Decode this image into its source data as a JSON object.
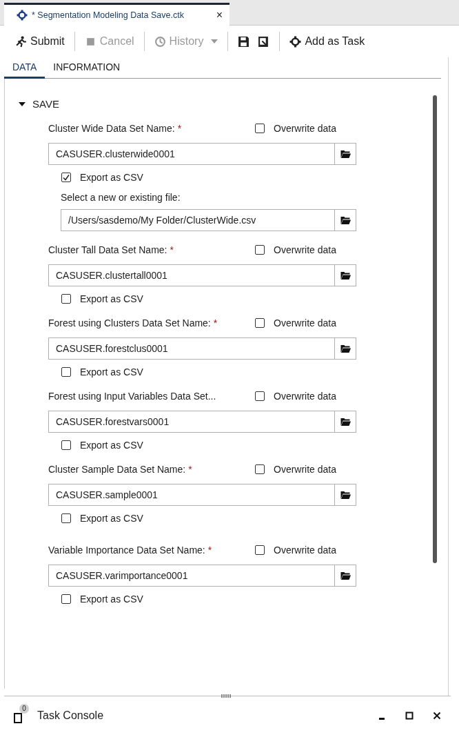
{
  "document_tab": {
    "title": "* Segmentation Modeling Data Save.ctk",
    "close": "×"
  },
  "toolbar": [
    {
      "kind": "submit",
      "label": "Submit",
      "disabled": false
    },
    {
      "kind": "cancel",
      "label": "Cancel",
      "disabled": true
    },
    {
      "kind": "history",
      "label": "History",
      "disabled": true
    },
    {
      "kind": "save",
      "disabled": false
    },
    {
      "kind": "save_as",
      "disabled": false
    },
    {
      "kind": "add_task",
      "label": "Add as Task",
      "disabled": false
    }
  ],
  "tabs": [
    {
      "label": "DATA",
      "selected": true
    },
    {
      "label": "INFORMATION",
      "selected": false
    }
  ],
  "section": {
    "title": "SAVE",
    "expanded": true
  },
  "outputs": [
    {
      "label": "Cluster Wide Data Set Name:",
      "required_mark": "*",
      "overwrite": {
        "label": "Overwrite data",
        "checked": false
      },
      "value": "CASUSER.clusterwide0001",
      "export": {
        "label": "Export as CSV",
        "checked": true
      },
      "file": {
        "label": "Select a new or existing file:",
        "value": "/Users/sasdemo/My Folder/ClusterWide.csv"
      }
    },
    {
      "label": "Cluster Tall Data Set Name:",
      "required_mark": "*",
      "overwrite": {
        "label": "Overwrite data",
        "checked": false
      },
      "value": "CASUSER.clustertall0001",
      "export": {
        "label": "Export as CSV",
        "checked": false
      }
    },
    {
      "label": "Forest using Clusters Data Set Name:",
      "required_mark": "*",
      "overwrite": {
        "label": "Overwrite data",
        "checked": false
      },
      "value": "CASUSER.forestclus0001",
      "export": {
        "label": "Export as CSV",
        "checked": false
      }
    },
    {
      "label": "Forest using Input Variables Data Set...",
      "overwrite": {
        "label": "Overwrite data",
        "checked": false
      },
      "value": "CASUSER.forestvars0001",
      "export": {
        "label": "Export as CSV",
        "checked": false
      }
    },
    {
      "label": "Cluster Sample Data Set Name:",
      "required_mark": "*",
      "overwrite": {
        "label": "Overwrite data",
        "checked": false
      },
      "value": "CASUSER.sample0001",
      "export": {
        "label": "Export as CSV",
        "checked": false
      }
    },
    {
      "label": "Variable Importance Data Set Name:",
      "required_mark": "*",
      "overwrite": {
        "label": "Overwrite data",
        "checked": false
      },
      "value": "CASUSER.varimportance0001",
      "export": {
        "label": "Export as CSV",
        "checked": false
      }
    }
  ],
  "console": {
    "badge": "0",
    "title": "Task Console"
  }
}
